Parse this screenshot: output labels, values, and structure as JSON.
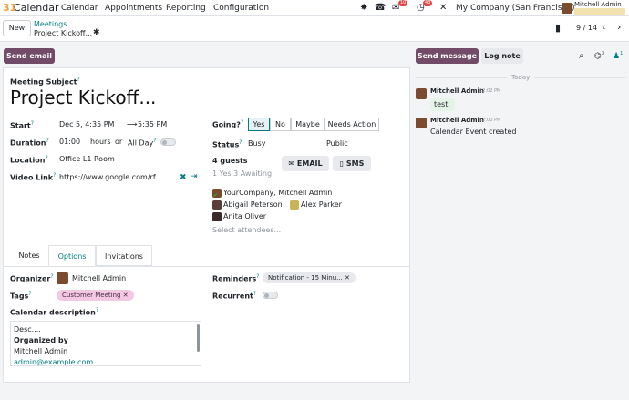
{
  "nav": {
    "app_title": "Calendar",
    "menus": [
      "Calendar",
      "Appointments",
      "Reporting",
      "Configuration"
    ],
    "messages_badge": "10",
    "activities_badge": "43",
    "company": "My Company (San Francisco)",
    "user": "Mitchell Admin"
  },
  "control": {
    "new_label": "New",
    "breadcrumb_parent": "Meetings",
    "breadcrumb_current": "Project Kickoff...",
    "pager": "9 / 14"
  },
  "actions": {
    "send_email": "Send email",
    "send_message": "Send message",
    "log_note": "Log note",
    "attachments_count": "3",
    "followers_count": "1"
  },
  "form": {
    "subject_label": "Meeting Subject",
    "subject": "Project Kickoff...",
    "start_label": "Start",
    "start": "Dec 5, 4:35 PM",
    "end": "5:35 PM",
    "duration_label": "Duration",
    "duration_value": "01:00",
    "duration_unit": "hours",
    "or_text": "or",
    "allday_label": "All Day",
    "location_label": "Location",
    "location": "Office L1 Room",
    "videolink_label": "Video Link",
    "videolink": "https://www.google.com/rf",
    "going_label": "Going?",
    "going_options": [
      "Yes",
      "No",
      "Maybe",
      "Needs Action"
    ],
    "status_label": "Status",
    "status_value": "Busy",
    "privacy_value": "Public",
    "guests_count": "4 guests",
    "guests_summary": "1 Yes  3 Awaiting",
    "email_btn": "EMAIL",
    "sms_btn": "SMS",
    "attendees": [
      "YourCompany, Mitchell Admin",
      "Abigail Peterson",
      "Alex Parker",
      "Anita Oliver"
    ],
    "select_attendees_placeholder": "Select attendees..."
  },
  "tabs": [
    "Notes",
    "Options",
    "Invitations"
  ],
  "options": {
    "organizer_label": "Organizer",
    "organizer": "Mitchell Admin",
    "tags_label": "Tags",
    "tag": "Customer Meeting",
    "reminders_label": "Reminders",
    "reminder": "Notification - 15 Minu...",
    "recurrent_label": "Recurrent",
    "description_label": "Calendar description",
    "description_lines": [
      "Desc....",
      "Organized by",
      "Mitchell Admin",
      "admin@example.com"
    ]
  },
  "chatter": {
    "today": "Today",
    "messages": [
      {
        "author": "Mitchell Admin",
        "time": "12:02 PM",
        "body": "test."
      },
      {
        "author": "Mitchell Admin",
        "time": "12:00 PM",
        "body": "Calendar Event created"
      }
    ]
  },
  "colors": {
    "brand": "#714b67",
    "accent": "#017e84",
    "tag_bg": "#f2c8e2",
    "reminder_bg": "#e7e9ed"
  }
}
